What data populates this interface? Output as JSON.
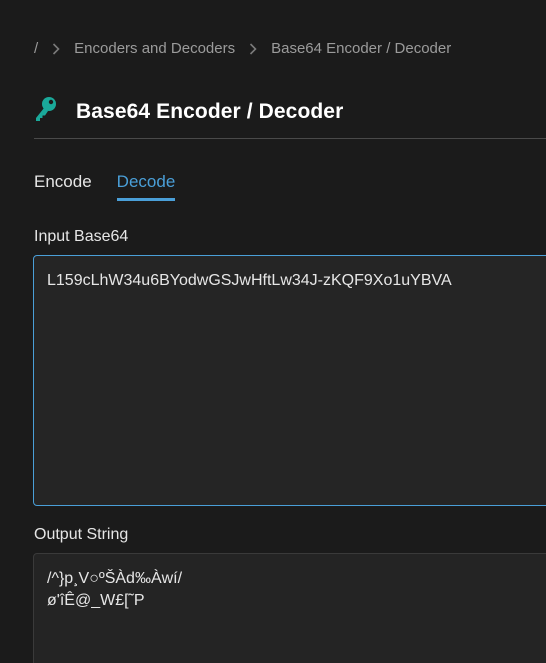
{
  "breadcrumb": {
    "root": "/",
    "items": [
      "Encoders and Decoders",
      "Base64 Encoder / Decoder"
    ]
  },
  "page": {
    "title": "Base64 Encoder / Decoder",
    "icon": "key-icon",
    "accent_color": "#4a9fd8",
    "icon_color": "#1aa99a"
  },
  "tabs": [
    {
      "label": "Encode",
      "active": false
    },
    {
      "label": "Decode",
      "active": true
    }
  ],
  "input": {
    "label": "Input Base64",
    "value": "L159cLhW34u6BYodwGSJwHftLw34J-zKQF9Xo1uYBVA"
  },
  "output": {
    "label": "Output String",
    "value": "/^}p¸V○ºŠÀd‰Àwí/\nø'îÊ@_W£[˜P"
  }
}
